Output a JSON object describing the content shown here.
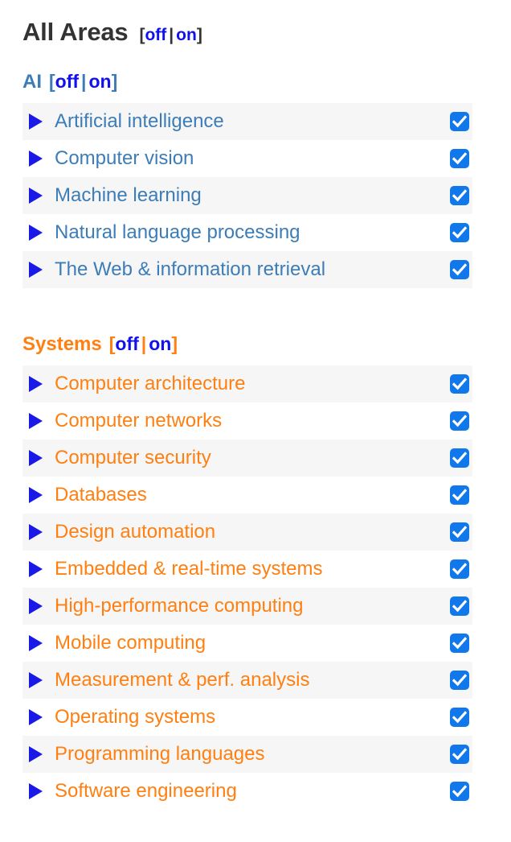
{
  "header": {
    "title": "All Areas",
    "toggle": {
      "open_bracket": "[",
      "off_label": "off",
      "separator": "|",
      "on_label": "on",
      "close_bracket": "]"
    }
  },
  "toggle_labels": {
    "open_bracket": "[",
    "off_label": "off",
    "separator": "|",
    "on_label": "on",
    "close_bracket": "]"
  },
  "colors": {
    "title": "#333333",
    "link_blue": "#1111ee",
    "triangle_blue": "#1a1ae6",
    "ai_accent": "#3c7db8",
    "systems_accent": "#ff7f10",
    "checkbox_blue": "#1178ec",
    "row_stripe": "#f6f6f6",
    "row_base": "#ffffff"
  },
  "sections": [
    {
      "name": "AI",
      "accent": "#3c7db8",
      "items": [
        {
          "label": "Artificial intelligence",
          "checked": true,
          "expander": "triangle-right-icon"
        },
        {
          "label": "Computer vision",
          "checked": true,
          "expander": "triangle-right-icon"
        },
        {
          "label": "Machine learning",
          "checked": true,
          "expander": "triangle-right-icon"
        },
        {
          "label": "Natural language processing",
          "checked": true,
          "expander": "triangle-right-icon"
        },
        {
          "label": "The Web & information retrieval",
          "checked": true,
          "expander": "triangle-right-icon"
        }
      ]
    },
    {
      "name": "Systems",
      "accent": "#ff7f10",
      "items": [
        {
          "label": "Computer architecture",
          "checked": true,
          "expander": "triangle-right-icon"
        },
        {
          "label": "Computer networks",
          "checked": true,
          "expander": "triangle-right-icon"
        },
        {
          "label": "Computer security",
          "checked": true,
          "expander": "triangle-right-icon"
        },
        {
          "label": "Databases",
          "checked": true,
          "expander": "triangle-right-icon"
        },
        {
          "label": "Design automation",
          "checked": true,
          "expander": "triangle-right-icon"
        },
        {
          "label": "Embedded & real-time systems",
          "checked": true,
          "expander": "triangle-right-icon"
        },
        {
          "label": "High-performance computing",
          "checked": true,
          "expander": "triangle-right-icon"
        },
        {
          "label": "Mobile computing",
          "checked": true,
          "expander": "triangle-right-icon"
        },
        {
          "label": "Measurement & perf. analysis",
          "checked": true,
          "expander": "triangle-right-icon"
        },
        {
          "label": "Operating systems",
          "checked": true,
          "expander": "triangle-right-icon"
        },
        {
          "label": "Programming languages",
          "checked": true,
          "expander": "triangle-right-icon"
        },
        {
          "label": "Software engineering",
          "checked": true,
          "expander": "triangle-right-icon"
        }
      ]
    }
  ]
}
